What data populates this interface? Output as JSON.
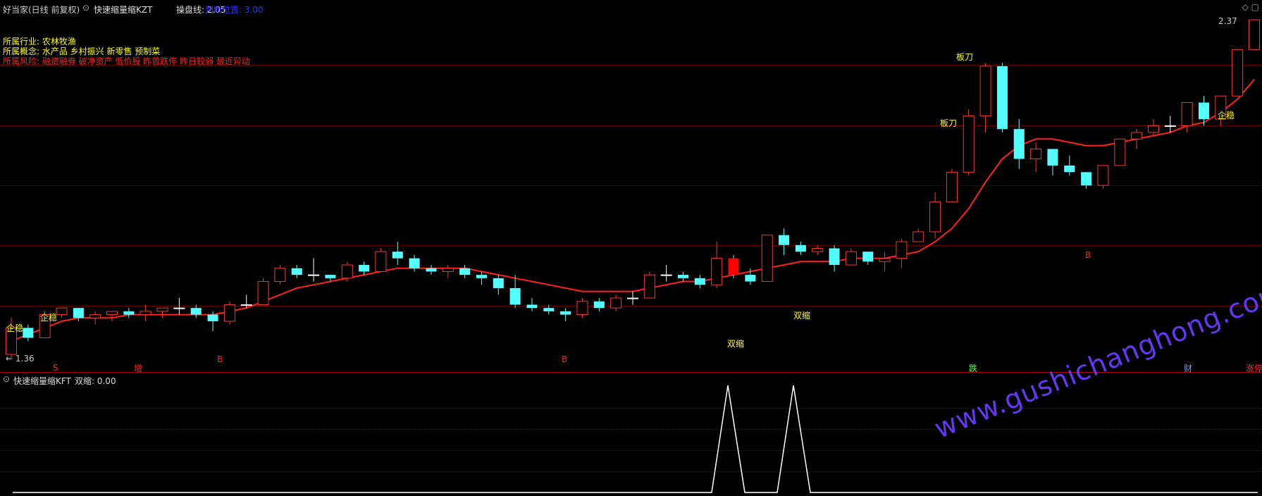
{
  "header": {
    "stock": "好当家(日线 前复权)",
    "indicator_main": "快速缩量缩KZT",
    "line_label": "操盘线: 2.05",
    "position_label": "判断位置: 3.00"
  },
  "info": {
    "industry": "所属行业: 农林牧渔",
    "concept": "所属概念: 水产品 乡村振兴 新零售 预制菜",
    "risk": "所属风险: 融资融券 破净资产 低价股 昨曾跌停 昨日较弱 最近异动"
  },
  "price_labels": {
    "high": "2.37",
    "low": "1.36"
  },
  "signals": [
    {
      "text": "企稳",
      "color": "#ffff00"
    },
    {
      "text": "企稳",
      "color": "#ffff00"
    },
    {
      "text": "企稳",
      "color": "#ffff00"
    },
    {
      "text": "双缩",
      "color": "#ffff00"
    },
    {
      "text": "双缩",
      "color": "#ffff00"
    },
    {
      "text": "板刀",
      "color": "#ffff00"
    },
    {
      "text": "板刀",
      "color": "#ffff00"
    },
    {
      "text": "B",
      "color": "#ff2020"
    },
    {
      "text": "B",
      "color": "#ff2020"
    },
    {
      "text": "B",
      "color": "#ff2020"
    },
    {
      "text": "S",
      "color": "#ff2020"
    },
    {
      "text": "增",
      "color": "#ff2020"
    },
    {
      "text": "跌",
      "color": "#44ff44"
    },
    {
      "text": "财",
      "color": "#6699ff"
    },
    {
      "text": "涨停",
      "color": "#ff2020"
    }
  ],
  "bottom": {
    "indicator": "快速缩量缩KFT",
    "value_label": "双缩: 0.00"
  },
  "watermark": "www.gushichanghong.com",
  "colors": {
    "up": "#ff3232",
    "down": "#54ffff",
    "ma_red": "#ff2020",
    "ma_green": "#00ff00",
    "ma_blue": "#2020ff",
    "ma_yellow": "#ffff00",
    "grid": "#6a0000",
    "watermark": "#6a3cff"
  },
  "chart_data": {
    "type": "candlestick",
    "candles": [
      [
        1.36,
        1.47,
        1.35,
        1.44
      ],
      [
        1.44,
        1.45,
        1.4,
        1.41
      ],
      [
        1.41,
        1.49,
        1.41,
        1.48
      ],
      [
        1.48,
        1.5,
        1.47,
        1.5
      ],
      [
        1.5,
        1.5,
        1.46,
        1.47
      ],
      [
        1.47,
        1.49,
        1.45,
        1.48
      ],
      [
        1.48,
        1.49,
        1.46,
        1.49
      ],
      [
        1.49,
        1.5,
        1.47,
        1.48
      ],
      [
        1.48,
        1.51,
        1.46,
        1.49
      ],
      [
        1.49,
        1.5,
        1.47,
        1.5
      ],
      [
        1.5,
        1.53,
        1.48,
        1.5
      ],
      [
        1.5,
        1.51,
        1.47,
        1.48
      ],
      [
        1.48,
        1.49,
        1.43,
        1.46
      ],
      [
        1.46,
        1.52,
        1.45,
        1.51
      ],
      [
        1.51,
        1.54,
        1.5,
        1.51
      ],
      [
        1.51,
        1.59,
        1.51,
        1.58
      ],
      [
        1.58,
        1.63,
        1.57,
        1.62
      ],
      [
        1.62,
        1.63,
        1.59,
        1.6
      ],
      [
        1.6,
        1.65,
        1.58,
        1.6
      ],
      [
        1.6,
        1.6,
        1.58,
        1.59
      ],
      [
        1.59,
        1.64,
        1.58,
        1.63
      ],
      [
        1.63,
        1.64,
        1.6,
        1.61
      ],
      [
        1.61,
        1.68,
        1.61,
        1.67
      ],
      [
        1.67,
        1.7,
        1.63,
        1.65
      ],
      [
        1.65,
        1.66,
        1.61,
        1.62
      ],
      [
        1.62,
        1.63,
        1.6,
        1.61
      ],
      [
        1.61,
        1.63,
        1.59,
        1.62
      ],
      [
        1.62,
        1.63,
        1.59,
        1.6
      ],
      [
        1.6,
        1.61,
        1.57,
        1.59
      ],
      [
        1.59,
        1.6,
        1.54,
        1.56
      ],
      [
        1.56,
        1.6,
        1.5,
        1.51
      ],
      [
        1.51,
        1.53,
        1.49,
        1.5
      ],
      [
        1.5,
        1.51,
        1.48,
        1.49
      ],
      [
        1.49,
        1.5,
        1.46,
        1.48
      ],
      [
        1.48,
        1.53,
        1.47,
        1.52
      ],
      [
        1.52,
        1.53,
        1.49,
        1.5
      ],
      [
        1.5,
        1.54,
        1.49,
        1.53
      ],
      [
        1.53,
        1.55,
        1.51,
        1.53
      ],
      [
        1.53,
        1.61,
        1.53,
        1.6
      ],
      [
        1.6,
        1.63,
        1.58,
        1.6
      ],
      [
        1.6,
        1.61,
        1.58,
        1.59
      ],
      [
        1.59,
        1.6,
        1.56,
        1.57
      ],
      [
        1.57,
        1.7,
        1.56,
        1.65
      ],
      [
        1.65,
        1.66,
        1.59,
        1.6
      ],
      [
        1.6,
        1.62,
        1.57,
        1.58
      ],
      [
        1.58,
        1.72,
        1.58,
        1.72
      ],
      [
        1.72,
        1.74,
        1.66,
        1.69
      ],
      [
        1.69,
        1.7,
        1.66,
        1.67
      ],
      [
        1.67,
        1.69,
        1.66,
        1.68
      ],
      [
        1.68,
        1.69,
        1.61,
        1.63
      ],
      [
        1.63,
        1.68,
        1.63,
        1.67
      ],
      [
        1.67,
        1.67,
        1.63,
        1.64
      ],
      [
        1.64,
        1.67,
        1.61,
        1.65
      ],
      [
        1.65,
        1.71,
        1.62,
        1.7
      ],
      [
        1.7,
        1.74,
        1.7,
        1.73
      ],
      [
        1.73,
        1.85,
        1.71,
        1.82
      ],
      [
        1.82,
        1.92,
        1.82,
        1.91
      ],
      [
        1.91,
        2.1,
        1.9,
        2.08
      ],
      [
        2.08,
        2.24,
        2.03,
        2.23
      ],
      [
        2.23,
        2.24,
        2.03,
        2.04
      ],
      [
        2.04,
        2.07,
        1.92,
        1.95
      ],
      [
        1.95,
        2.0,
        1.91,
        1.98
      ],
      [
        1.98,
        1.98,
        1.9,
        1.93
      ],
      [
        1.93,
        1.96,
        1.9,
        1.91
      ],
      [
        1.91,
        1.91,
        1.86,
        1.87
      ],
      [
        1.87,
        1.93,
        1.86,
        1.93
      ],
      [
        1.93,
        2.01,
        1.93,
        2.01
      ],
      [
        2.01,
        2.04,
        1.98,
        2.03
      ],
      [
        2.03,
        2.07,
        2.02,
        2.05
      ],
      [
        2.05,
        2.08,
        2.03,
        2.05
      ],
      [
        2.05,
        2.12,
        2.03,
        2.12
      ],
      [
        2.12,
        2.14,
        2.05,
        2.07
      ],
      [
        2.07,
        2.14,
        2.05,
        2.14
      ],
      [
        2.14,
        2.28,
        2.14,
        2.28
      ],
      [
        2.28,
        2.37,
        2.28,
        2.37
      ]
    ],
    "limit_up_bars": [
      43,
      76
    ],
    "ma_red": [
      1.4,
      1.42,
      1.44,
      1.46,
      1.47,
      1.47,
      1.47,
      1.48,
      1.48,
      1.48,
      1.48,
      1.48,
      1.48,
      1.49,
      1.5,
      1.52,
      1.54,
      1.56,
      1.57,
      1.58,
      1.59,
      1.6,
      1.61,
      1.62,
      1.62,
      1.62,
      1.62,
      1.62,
      1.61,
      1.6,
      1.59,
      1.58,
      1.57,
      1.56,
      1.55,
      1.55,
      1.55,
      1.55,
      1.56,
      1.57,
      1.58,
      1.58,
      1.59,
      1.6,
      1.61,
      1.62,
      1.63,
      1.64,
      1.64,
      1.64,
      1.65,
      1.65,
      1.65,
      1.66,
      1.67,
      1.7,
      1.74,
      1.8,
      1.88,
      1.95,
      1.99,
      2.01,
      2.01,
      2.0,
      1.99,
      1.99,
      2.0,
      2.01,
      2.02,
      2.03,
      2.05,
      2.06,
      2.09,
      2.13,
      2.19
    ],
    "xlabel": "",
    "ylabel": ""
  }
}
